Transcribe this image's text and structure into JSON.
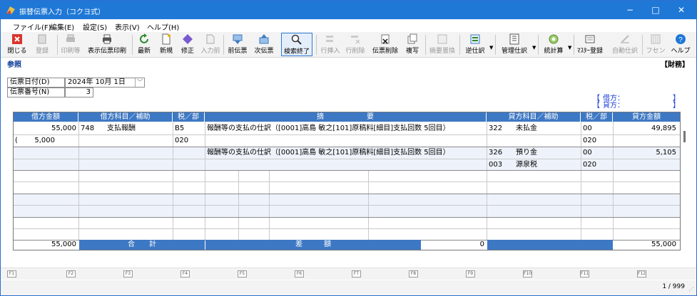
{
  "window": {
    "title": "振替伝票入力（コクヨ式）",
    "min": "−",
    "max": "□",
    "close": "✕"
  },
  "menu": [
    "ファイル(F)",
    "編集(E)",
    "設定(S)",
    "表示(V)",
    "ヘルプ(H)"
  ],
  "toolbar": [
    {
      "label": "閉じる",
      "icon": "close-icon",
      "disabled": false
    },
    {
      "label": "登録",
      "icon": "register-icon",
      "disabled": true
    },
    {
      "label": "印刷等",
      "icon": "printer-icon",
      "disabled": true
    },
    {
      "label": "表示伝票印刷",
      "icon": "printer-icon",
      "disabled": false
    },
    {
      "label": "最新",
      "icon": "refresh-icon",
      "disabled": false
    },
    {
      "label": "新規",
      "icon": "new-icon",
      "disabled": false
    },
    {
      "label": "修正",
      "icon": "edit-icon",
      "disabled": false
    },
    {
      "label": "入力前",
      "icon": "undo-icon",
      "disabled": true
    },
    {
      "label": "前伝票",
      "icon": "prev-voucher-icon",
      "disabled": false
    },
    {
      "label": "次伝票",
      "icon": "next-voucher-icon",
      "disabled": false
    },
    {
      "label": "検索終了",
      "icon": "search-icon",
      "disabled": false,
      "selected": true
    },
    {
      "label": "行挿入",
      "icon": "insert-row-icon",
      "disabled": true
    },
    {
      "label": "行削除",
      "icon": "delete-row-icon",
      "disabled": true
    },
    {
      "label": "伝票削除",
      "icon": "delete-voucher-icon",
      "disabled": false
    },
    {
      "label": "複写",
      "icon": "copy-icon",
      "disabled": false
    },
    {
      "label": "摘要置換",
      "icon": "replace-icon",
      "disabled": true
    },
    {
      "label": "逆仕訳",
      "icon": "reverse-icon",
      "disabled": false,
      "dropdown": true
    },
    {
      "label": "管理仕訳",
      "icon": "manage-icon",
      "disabled": false,
      "dropdown": true
    },
    {
      "label": "統計算",
      "icon": "calc-icon",
      "disabled": false,
      "dropdown": true
    },
    {
      "label": "ﾏｽﾀｰ登録",
      "icon": "master-icon",
      "disabled": false
    },
    {
      "label": "自動仕訳",
      "icon": "auto-entry-icon",
      "disabled": true
    },
    {
      "label": "フセン",
      "icon": "sticky-note-icon",
      "disabled": true
    },
    {
      "label": "ヘルプ",
      "icon": "help-icon",
      "disabled": false
    }
  ],
  "mode": {
    "left": "参照",
    "right": "【財務】"
  },
  "form": {
    "date_label": "伝票日付(D)",
    "date_value": "2024年 10月  1日",
    "number_label": "伝票番号(N)",
    "number_value": "3"
  },
  "summary": {
    "debit_label": "借方：",
    "credit_label": "貸方：",
    "open": "【",
    "close": "】"
  },
  "grid": {
    "headers": [
      "借方金額",
      "借方科目／補助",
      "税／部",
      "摘　　　　　　要",
      "貸方科目／補助",
      "税／部",
      "貸方金額"
    ],
    "rows": [
      {
        "debit_amount": "55,000",
        "debit_account": "748",
        "debit_name": "支払報酬",
        "debit_tax": "B5",
        "description": "報酬等の支払の仕訳（[0001]高島 敏之[101]原稿料[細目]支払回数 5回目）",
        "credit_account": "322",
        "credit_name": "未払金",
        "credit_tax": "00",
        "credit_amount": "49,895"
      },
      {
        "debit_amount": "5,000",
        "debit_prefix": "(",
        "debit_account": "",
        "debit_name": "",
        "debit_tax": "020",
        "description": "",
        "credit_account": "",
        "credit_name": "",
        "credit_tax": "020",
        "credit_amount": ""
      },
      {
        "debit_amount": "",
        "debit_account": "",
        "debit_name": "",
        "debit_tax": "",
        "description": "報酬等の支払の仕訳（[0001]高島 敏之[101]原稿料[細目]支払回数 5回目）",
        "credit_account": "326",
        "credit_name": "預り金",
        "credit_tax": "00",
        "credit_amount": "5,105"
      },
      {
        "debit_amount": "",
        "debit_account": "",
        "debit_name": "",
        "debit_tax": "",
        "description": "",
        "credit_account": "003",
        "credit_name": "源泉税",
        "credit_tax": "020",
        "credit_amount": ""
      }
    ],
    "total_debit": "55,000",
    "total_label": "合　　計",
    "diff_label": "差　　　額",
    "diff_value": "0",
    "total_credit": "55,000"
  },
  "fkeys": [
    "F1",
    "F2",
    "F3",
    "F4",
    "F5",
    "F6",
    "F7",
    "F8",
    "F9",
    "F10",
    "F11",
    "F12"
  ],
  "status": {
    "page": "1 / 999"
  },
  "colors": {
    "titlebar": "#1f78d6",
    "header": "#3d78c4",
    "accent_text": "#1b3fd8"
  }
}
